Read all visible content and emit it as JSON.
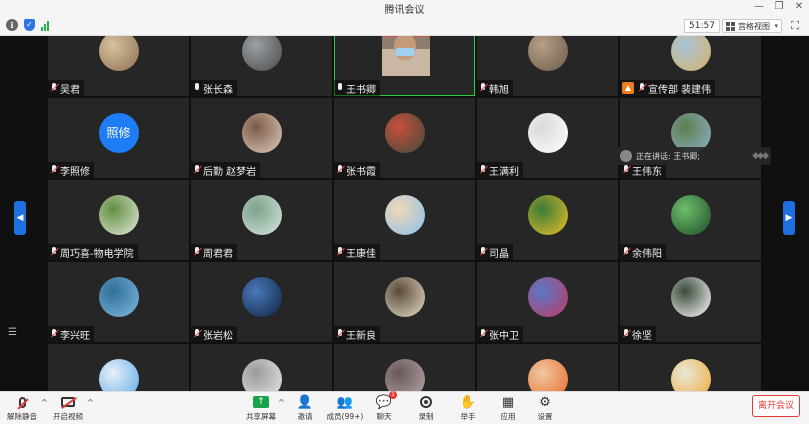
{
  "window": {
    "title": "腾讯会议"
  },
  "topbar": {
    "timer": "51:57",
    "view_label": "宫格视图"
  },
  "participants": [
    {
      "name": "吴君",
      "muted": true,
      "avatar": "photo",
      "colors": [
        "#8b6f4e",
        "#d8c2a0"
      ]
    },
    {
      "name": "张长森",
      "muted": false,
      "avatar": "photo",
      "colors": [
        "#4a4a4a",
        "#9aa0a4"
      ]
    },
    {
      "name": "王书卿",
      "muted": false,
      "avatar": "camera",
      "active": true
    },
    {
      "name": "韩旭",
      "muted": true,
      "avatar": "photo",
      "colors": [
        "#6a5a4a",
        "#b89f86"
      ]
    },
    {
      "name": "宣传部 裴建伟",
      "muted": true,
      "avatar": "photo",
      "colors": [
        "#d6b26a",
        "#a8c4d8"
      ],
      "badge": true
    },
    {
      "name": "李照修",
      "muted": true,
      "avatar": "text",
      "initials": "照修"
    },
    {
      "name": "后勤 赵梦岩",
      "muted": true,
      "avatar": "photo",
      "colors": [
        "#e2cdbf",
        "#7a5a46"
      ]
    },
    {
      "name": "张书霞",
      "muted": true,
      "avatar": "photo",
      "colors": [
        "#3e4a3a",
        "#c8503a"
      ]
    },
    {
      "name": "王满利",
      "muted": true,
      "avatar": "photo",
      "colors": [
        "#ffffff",
        "#d9d9d9"
      ]
    },
    {
      "name": "王伟东",
      "muted": true,
      "avatar": "photo",
      "colors": [
        "#8fb0c8",
        "#5d7f4f"
      ]
    },
    {
      "name": "周巧喜-物电学院",
      "muted": true,
      "avatar": "photo",
      "colors": [
        "#e8e8e0",
        "#5f8f3e"
      ]
    },
    {
      "name": "周君君",
      "muted": true,
      "avatar": "photo",
      "colors": [
        "#d8e4dc",
        "#7aa38c"
      ]
    },
    {
      "name": "王康佳",
      "muted": true,
      "avatar": "photo",
      "colors": [
        "#8ac0e8",
        "#f0d8b8"
      ]
    },
    {
      "name": "司晶",
      "muted": true,
      "avatar": "photo",
      "colors": [
        "#e8c028",
        "#3c7a38"
      ]
    },
    {
      "name": "余伟阳",
      "muted": true,
      "avatar": "photo",
      "colors": [
        "#1e4a2a",
        "#6ec06a"
      ]
    },
    {
      "name": "李兴旺",
      "muted": true,
      "avatar": "photo",
      "colors": [
        "#7fb8e0",
        "#2f6f98"
      ]
    },
    {
      "name": "张岩松",
      "muted": true,
      "avatar": "photo",
      "colors": [
        "#0f2444",
        "#4a78b8"
      ]
    },
    {
      "name": "王新良",
      "muted": true,
      "avatar": "photo",
      "colors": [
        "#e8dcc8",
        "#5a4a3a"
      ]
    },
    {
      "name": "张中卫",
      "muted": true,
      "avatar": "photo",
      "colors": [
        "#c03860",
        "#5a78c8"
      ]
    },
    {
      "name": "徐坚",
      "muted": true,
      "avatar": "photo",
      "colors": [
        "#ffffff",
        "#3a4a3a"
      ]
    },
    {
      "name": "",
      "muted": true,
      "avatar": "photo",
      "colors": [
        "#5aa8e8",
        "#e8f0f8"
      ]
    },
    {
      "name": "",
      "muted": true,
      "avatar": "photo",
      "colors": [
        "#e8e8e8",
        "#9a9a9a"
      ]
    },
    {
      "name": "",
      "muted": true,
      "avatar": "photo",
      "colors": [
        "#b8a8a8",
        "#6a5858"
      ]
    },
    {
      "name": "",
      "muted": true,
      "avatar": "photo",
      "colors": [
        "#e86a2a",
        "#f0c8a0"
      ]
    },
    {
      "name": "",
      "muted": true,
      "avatar": "photo",
      "colors": [
        "#f0a838",
        "#e8e8d8"
      ]
    }
  ],
  "speaking": {
    "text": "正在讲话: 王书卿;"
  },
  "toolbar": {
    "unmute": "解除静音",
    "start_video": "开启视频",
    "share_screen": "共享屏幕",
    "invite": "邀请",
    "members": "成员(99+)",
    "chat": "聊天",
    "chat_badge": "1",
    "record": "录制",
    "raise_hand": "举手",
    "apps": "应用",
    "settings": "设置",
    "leave": "离开会议"
  }
}
